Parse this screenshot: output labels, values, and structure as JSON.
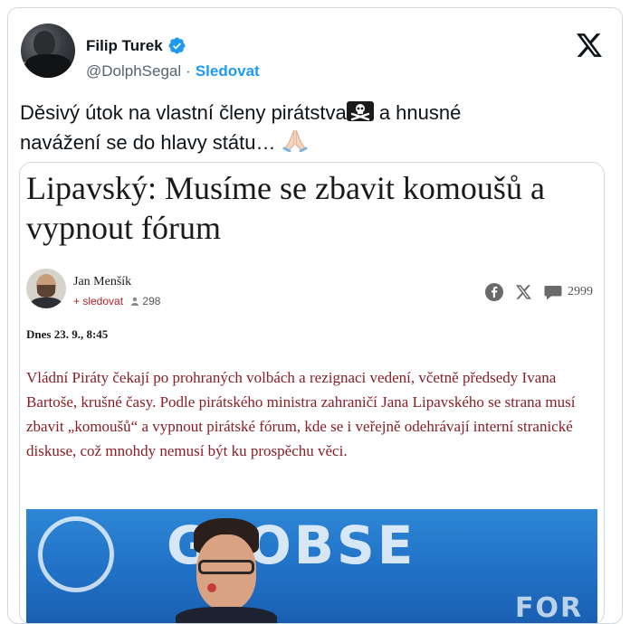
{
  "tweet": {
    "author_name": "Filip Turek",
    "handle": "@DolphSegal",
    "separator": "·",
    "follow_label": "Sledovat",
    "text_line1": "Děsivý útok na vlastní členy pirátstva",
    "text_line1_end": " a hnusné",
    "text_line2": "navážení se do hlavy státu… ",
    "emoji_1": "☠️",
    "emoji_2": "🙏🏻"
  },
  "article": {
    "title": "Lipavský: Musíme se zbavit komoušů a vypnout fórum",
    "author": "Jan Menšík",
    "follow_label": "+ sledovat",
    "followers": "298",
    "comments": "2999",
    "date": "Dnes 23. 9., 8:45",
    "lede": "Vládní Piráty čekají po prohraných volbách a rezignaci vedení, včetně předsedy Ivana Bartoše, krušné časy. Podle pirátského ministra zahraničí Jana Lipavského se strana musí zbavit „komoušů“ a vypnout pirátské fórum, kde se i veřejně odehrávají interní stranické diskuse, což mnohdy nemusí být ku prospěchu věci.",
    "photo_text": "GLOBSE",
    "photo_text_2": "FOR"
  },
  "colors": {
    "link_blue": "#1d9bf0",
    "lede_red": "#8b1e24",
    "verified_blue": "#1d9bf0"
  },
  "icons": [
    "verified-badge-icon",
    "x-logo-icon",
    "person-icon",
    "facebook-icon",
    "x-share-icon",
    "comment-icon"
  ]
}
